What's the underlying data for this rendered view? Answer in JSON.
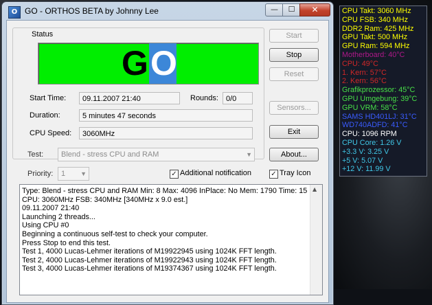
{
  "window": {
    "title": "GO - ORTHOS BETA by Johnny Lee",
    "icon_label": "O",
    "controls": {
      "minimize": "—",
      "maximize": "☐",
      "close": "✕"
    }
  },
  "status": {
    "group_label": "Status",
    "indicator_text_g": "G",
    "indicator_text_o": "O",
    "indicator_color": "#00ee00",
    "start_time_label": "Start Time:",
    "start_time_value": "09.11.2007 21:40",
    "rounds_label": "Rounds:",
    "rounds_value": "0/0",
    "duration_label": "Duration:",
    "duration_value": "5 minutes 47 seconds",
    "cpu_speed_label": "CPU Speed:",
    "cpu_speed_value": "3060MHz"
  },
  "buttons": {
    "start": "Start",
    "stop": "Stop",
    "reset": "Reset",
    "sensors": "Sensors...",
    "exit": "Exit",
    "about": "About..."
  },
  "options": {
    "test_label": "Test:",
    "test_value": "Blend - stress CPU and RAM",
    "priority_label": "Priority:",
    "priority_value": "1",
    "additional_notification_label": "Additional notification",
    "additional_notification_checked": true,
    "tray_icon_label": "Tray Icon",
    "tray_icon_checked": true
  },
  "log": [
    "Type: Blend - stress CPU and RAM Min: 8 Max: 4096 InPlace: No Mem: 1790 Time: 15",
    "CPU: 3060MHz FSB: 340MHz [340MHz x 9.0 est.]",
    "09.11.2007 21:40",
    "Launching 2 threads...",
    "Using CPU #0",
    "Beginning a continuous self-test to check your computer.",
    "Press Stop to end this test.",
    "Test 1, 4000 Lucas-Lehmer iterations of M19922945 using 1024K FFT length.",
    "Test 2, 4000 Lucas-Lehmer iterations of M19922943 using 1024K FFT length.",
    "Test 3, 4000 Lucas-Lehmer iterations of M19374367 using 1024K FFT length."
  ],
  "sensor_gadget": [
    {
      "text": "CPU Takt: 3060 MHz",
      "color": "#ffff00"
    },
    {
      "text": "CPU FSB: 340 MHz",
      "color": "#ffff00"
    },
    {
      "text": "DDR2 Ram: 425 MHz",
      "color": "#ffff00"
    },
    {
      "text": "GPU Takt: 500 MHz",
      "color": "#ffff00"
    },
    {
      "text": "GPU Ram: 594 MHz",
      "color": "#ffff00"
    },
    {
      "text": "Motherboard: 40°C",
      "color": "#b0188a"
    },
    {
      "text": "CPU: 49°C",
      "color": "#d02828"
    },
    {
      "text": "1. Kern: 57°C",
      "color": "#d02828"
    },
    {
      "text": "2. Kern: 56°C",
      "color": "#d02828"
    },
    {
      "text": "Grafikprozessor: 45°C",
      "color": "#48e048"
    },
    {
      "text": "GPU Umgebung: 39°C",
      "color": "#48e048"
    },
    {
      "text": "GPU VRM: 58°C",
      "color": "#48e048"
    },
    {
      "text": "SAMS HD401LJ: 31°C",
      "color": "#3a5cff"
    },
    {
      "text": "WD740ADFD: 41°C",
      "color": "#3a5cff"
    },
    {
      "text": "CPU: 1096 RPM",
      "color": "#ffffff"
    },
    {
      "text": "CPU Core: 1.26 V",
      "color": "#40c8e8"
    },
    {
      "text": "+3.3 V: 3.25 V",
      "color": "#40c8e8"
    },
    {
      "text": "+5 V: 5.07 V",
      "color": "#40c8e8"
    },
    {
      "text": "+12 V: 11.99 V",
      "color": "#40c8e8"
    }
  ]
}
